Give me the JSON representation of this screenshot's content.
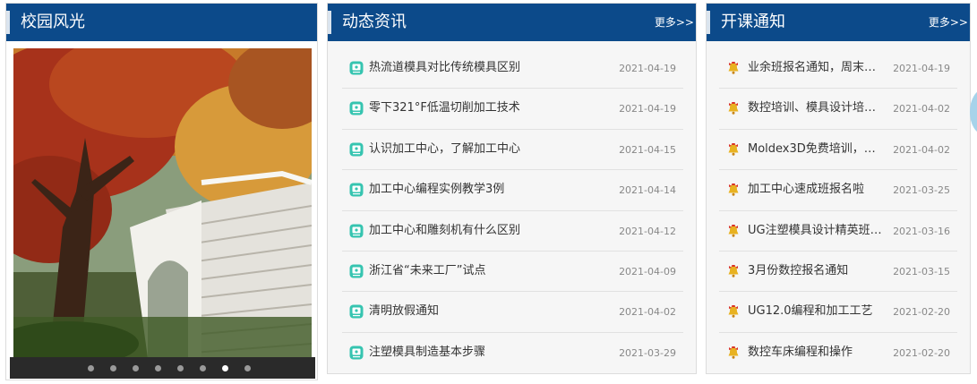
{
  "campus": {
    "title": "校园风光",
    "dots": 8,
    "active_dot": 7
  },
  "news": {
    "title": "动态资讯",
    "more": "更多>>",
    "items": [
      {
        "title": "热流道模具对比传统模具区别",
        "date": "2021-04-19"
      },
      {
        "title": "零下321°F低温切削加工技术",
        "date": "2021-04-19"
      },
      {
        "title": "认识加工中心，了解加工中心",
        "date": "2021-04-15"
      },
      {
        "title": "加工中心编程实例教学3例",
        "date": "2021-04-14"
      },
      {
        "title": "加工中心和雕刻机有什么区别",
        "date": "2021-04-12"
      },
      {
        "title": "浙江省“未来工厂”试点",
        "date": "2021-04-09"
      },
      {
        "title": "清明放假通知",
        "date": "2021-04-02"
      },
      {
        "title": "注塑模具制造基本步骤",
        "date": "2021-03-29"
      }
    ]
  },
  "courses": {
    "title": "开课通知",
    "more": "更多>>",
    "items": [
      {
        "title": "业余班报名通知，周末…",
        "date": "2021-04-19"
      },
      {
        "title": "数控培训、模具设计培…",
        "date": "2021-04-02"
      },
      {
        "title": "Moldex3D免费培训，…",
        "date": "2021-04-02"
      },
      {
        "title": "加工中心速成班报名啦",
        "date": "2021-03-25"
      },
      {
        "title": "UG注塑模具设计精英班…",
        "date": "2021-03-16"
      },
      {
        "title": "3月份数控报名通知",
        "date": "2021-03-15"
      },
      {
        "title": "UG12.0编程和加工工艺",
        "date": "2021-02-20"
      },
      {
        "title": "数控车床编程和操作",
        "date": "2021-02-20"
      }
    ]
  },
  "colors": {
    "header": "#0c4a8a",
    "news_icon": "#36c4b0",
    "bell_icon": "#e8b221"
  },
  "icons": {
    "news": "news-doc-icon",
    "courses": "bell-icon"
  }
}
